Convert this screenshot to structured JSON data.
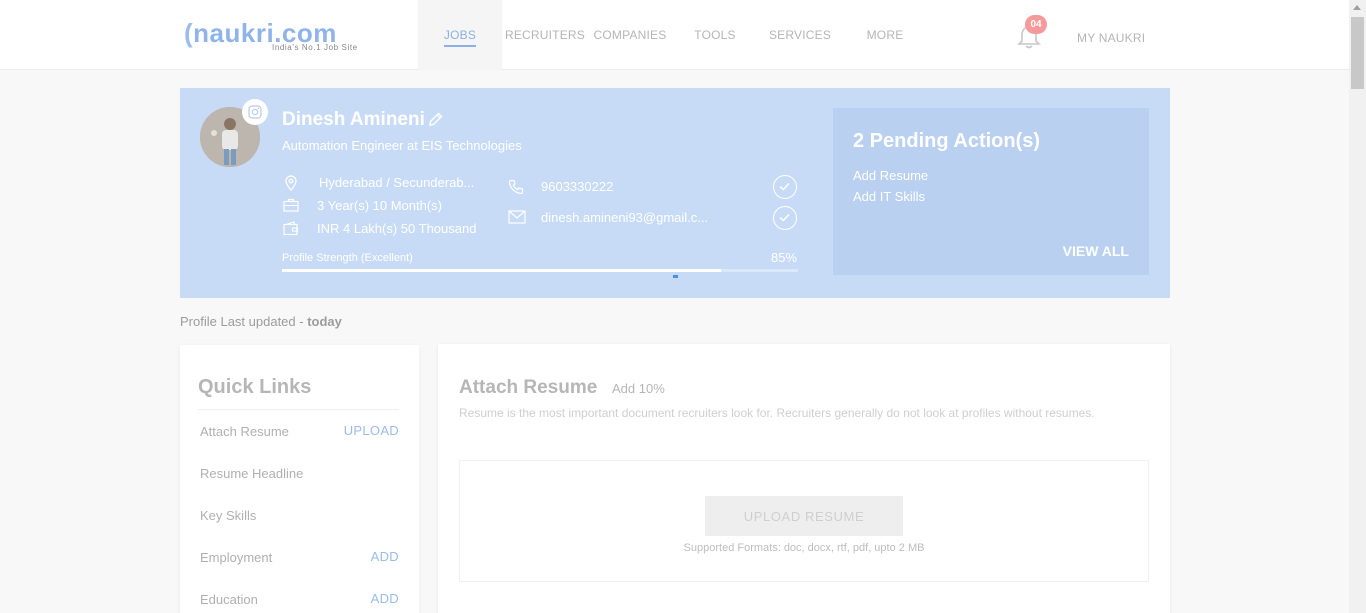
{
  "header": {
    "logo_text": "naukri.com",
    "logo_tagline": "India's No.1 Job Site",
    "nav": [
      {
        "label": "JOBS",
        "active": true
      },
      {
        "label": "RECRUITERS",
        "active": false
      },
      {
        "label": "COMPANIES",
        "active": false
      },
      {
        "label": "TOOLS",
        "active": false
      },
      {
        "label": "SERVICES",
        "active": false
      },
      {
        "label": "MORE",
        "active": false
      }
    ],
    "notification_count": "04",
    "my_naukri": "MY NAUKRI"
  },
  "profile": {
    "name": "Dinesh Amineni",
    "headline": "Automation Engineer at EIS Technologies",
    "location": "Hyderabad / Secunderab...",
    "experience": "3 Year(s) 10 Month(s)",
    "salary": "INR 4 Lakh(s) 50 Thousand",
    "phone": "9603330222",
    "email": "dinesh.amineni93@gmail.c...",
    "strength_label": "Profile Strength (Excellent)",
    "strength_pct": "85%",
    "strength_value": 0.85
  },
  "pending": {
    "title": "2 Pending Action(s)",
    "items": [
      "Add Resume",
      "Add IT Skills"
    ],
    "view_all": "VIEW ALL"
  },
  "last_updated": {
    "prefix": "Profile Last updated - ",
    "value": "today"
  },
  "quick_links": {
    "title": "Quick Links",
    "items": [
      {
        "label": "Attach Resume",
        "action": "UPLOAD"
      },
      {
        "label": "Resume Headline",
        "action": ""
      },
      {
        "label": "Key Skills",
        "action": ""
      },
      {
        "label": "Employment",
        "action": "ADD"
      },
      {
        "label": "Education",
        "action": "ADD"
      }
    ]
  },
  "attach_resume": {
    "title": "Attach Resume",
    "add_label": "Add 10%",
    "description": "Resume is the most important document recruiters look for. Recruiters generally do not look at profiles without resumes.",
    "button": "UPLOAD RESUME",
    "formats": "Supported Formats: doc, docx, rtf, pdf, upto 2 MB"
  },
  "colors": {
    "brand_blue": "#8fb4ea",
    "banner_bg": "#c7dbf6",
    "pending_bg": "#b9d0f0",
    "badge_red": "#f49a9a"
  }
}
